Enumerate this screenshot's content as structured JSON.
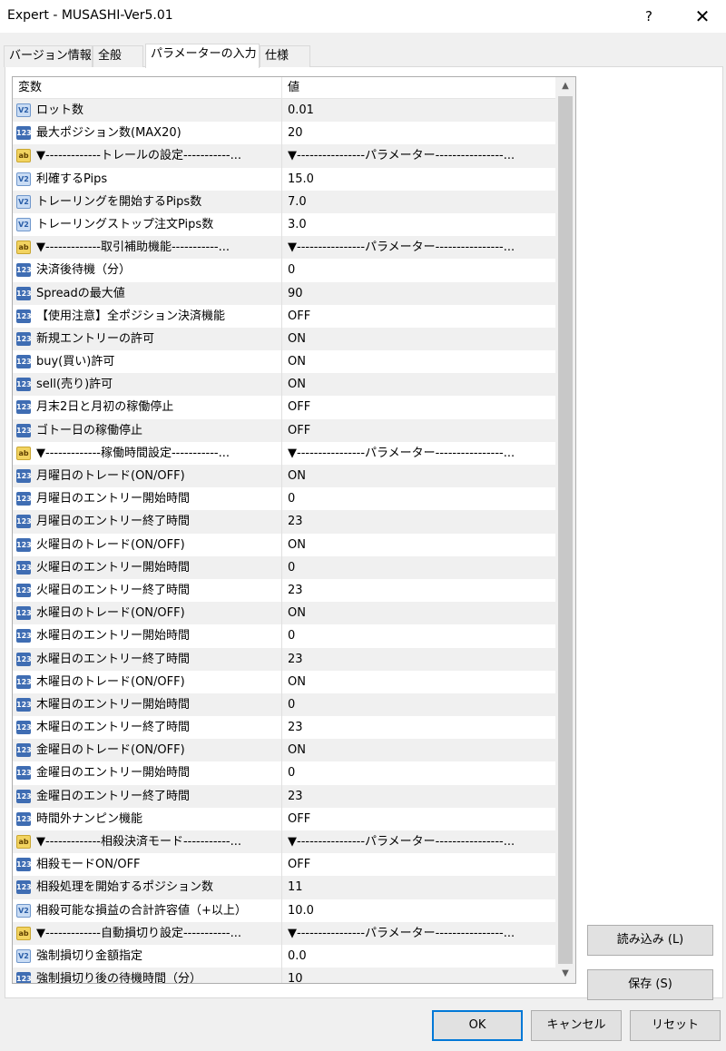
{
  "window": {
    "title": "Expert - MUSASHI-Ver5.01",
    "help_label": "?",
    "close_label": "✕"
  },
  "tabs": [
    {
      "label": "バージョン情報"
    },
    {
      "label": "全般"
    },
    {
      "label": "パラメーターの入力"
    },
    {
      "label": "仕様"
    }
  ],
  "active_tab": 2,
  "grid": {
    "header": {
      "name": "変数",
      "value": "値"
    },
    "rows": [
      {
        "type": "dbl",
        "name": "ロット数",
        "value": "0.01"
      },
      {
        "type": "int",
        "name": "最大ポジション数(MAX20)",
        "value": "20"
      },
      {
        "type": "str",
        "name": "▼-------------トレールの設定-----------...",
        "value": "▼----------------パラメーター----------------..."
      },
      {
        "type": "dbl",
        "name": "利確するPips",
        "value": "15.0"
      },
      {
        "type": "dbl",
        "name": "トレーリングを開始するPips数",
        "value": "7.0"
      },
      {
        "type": "dbl",
        "name": "トレーリングストップ注文Pips数",
        "value": "3.0"
      },
      {
        "type": "str",
        "name": "▼-------------取引補助機能-----------...",
        "value": "▼----------------パラメーター----------------..."
      },
      {
        "type": "int",
        "name": "決済後待機（分）",
        "value": "0"
      },
      {
        "type": "int",
        "name": "Spreadの最大値",
        "value": "90"
      },
      {
        "type": "int",
        "name": "【使用注意】全ポジション決済機能",
        "value": "OFF"
      },
      {
        "type": "int",
        "name": "新規エントリーの許可",
        "value": "ON"
      },
      {
        "type": "int",
        "name": "buy(買い)許可",
        "value": "ON"
      },
      {
        "type": "int",
        "name": "sell(売り)許可",
        "value": "ON"
      },
      {
        "type": "int",
        "name": "月末2日と月初の稼働停止",
        "value": "OFF"
      },
      {
        "type": "int",
        "name": "ゴトー日の稼働停止",
        "value": "OFF"
      },
      {
        "type": "str",
        "name": "▼-------------稼働時間設定-----------...",
        "value": "▼----------------パラメーター----------------..."
      },
      {
        "type": "int",
        "name": "月曜日のトレード(ON/OFF)",
        "value": "ON"
      },
      {
        "type": "int",
        "name": "月曜日のエントリー開始時間",
        "value": "0"
      },
      {
        "type": "int",
        "name": "月曜日のエントリー終了時間",
        "value": "23"
      },
      {
        "type": "int",
        "name": "火曜日のトレード(ON/OFF)",
        "value": "ON"
      },
      {
        "type": "int",
        "name": "火曜日のエントリー開始時間",
        "value": "0"
      },
      {
        "type": "int",
        "name": "火曜日のエントリー終了時間",
        "value": "23"
      },
      {
        "type": "int",
        "name": "水曜日のトレード(ON/OFF)",
        "value": "ON"
      },
      {
        "type": "int",
        "name": "水曜日のエントリー開始時間",
        "value": "0"
      },
      {
        "type": "int",
        "name": "水曜日のエントリー終了時間",
        "value": "23"
      },
      {
        "type": "int",
        "name": "木曜日のトレード(ON/OFF)",
        "value": "ON"
      },
      {
        "type": "int",
        "name": "木曜日のエントリー開始時間",
        "value": "0"
      },
      {
        "type": "int",
        "name": "木曜日のエントリー終了時間",
        "value": "23"
      },
      {
        "type": "int",
        "name": "金曜日のトレード(ON/OFF)",
        "value": "ON"
      },
      {
        "type": "int",
        "name": "金曜日のエントリー開始時間",
        "value": "0"
      },
      {
        "type": "int",
        "name": "金曜日のエントリー終了時間",
        "value": "23"
      },
      {
        "type": "int",
        "name": "時間外ナンピン機能",
        "value": "OFF"
      },
      {
        "type": "str",
        "name": "▼-------------相殺決済モード-----------...",
        "value": "▼----------------パラメーター----------------..."
      },
      {
        "type": "int",
        "name": "相殺モードON/OFF",
        "value": "OFF"
      },
      {
        "type": "int",
        "name": "相殺処理を開始するポジション数",
        "value": "11"
      },
      {
        "type": "dbl",
        "name": "相殺可能な損益の合計許容値（+以上）",
        "value": "10.0"
      },
      {
        "type": "str",
        "name": "▼-------------自動損切り設定-----------...",
        "value": "▼----------------パラメーター----------------..."
      },
      {
        "type": "dbl",
        "name": "強制損切り金額指定",
        "value": "0.0"
      },
      {
        "type": "int",
        "name": "強制損切り後の待機時間（分）",
        "value": "10"
      }
    ]
  },
  "type_icons": {
    "int": "123",
    "dbl": "V2",
    "str": "ab"
  },
  "scroll": {
    "up": "▲",
    "down": "▼"
  },
  "buttons": {
    "load": "読み込み (L)",
    "save": "保存 (S)",
    "ok": "OK",
    "cancel": "キャンセル",
    "reset": "リセット"
  },
  "colors": {
    "alt_row": "#f0f0f0",
    "int_icon": "#3f6db3",
    "dbl_icon": "#c9dcf4",
    "str_icon": "#f2d360",
    "default_button_border": "#0078d7"
  }
}
